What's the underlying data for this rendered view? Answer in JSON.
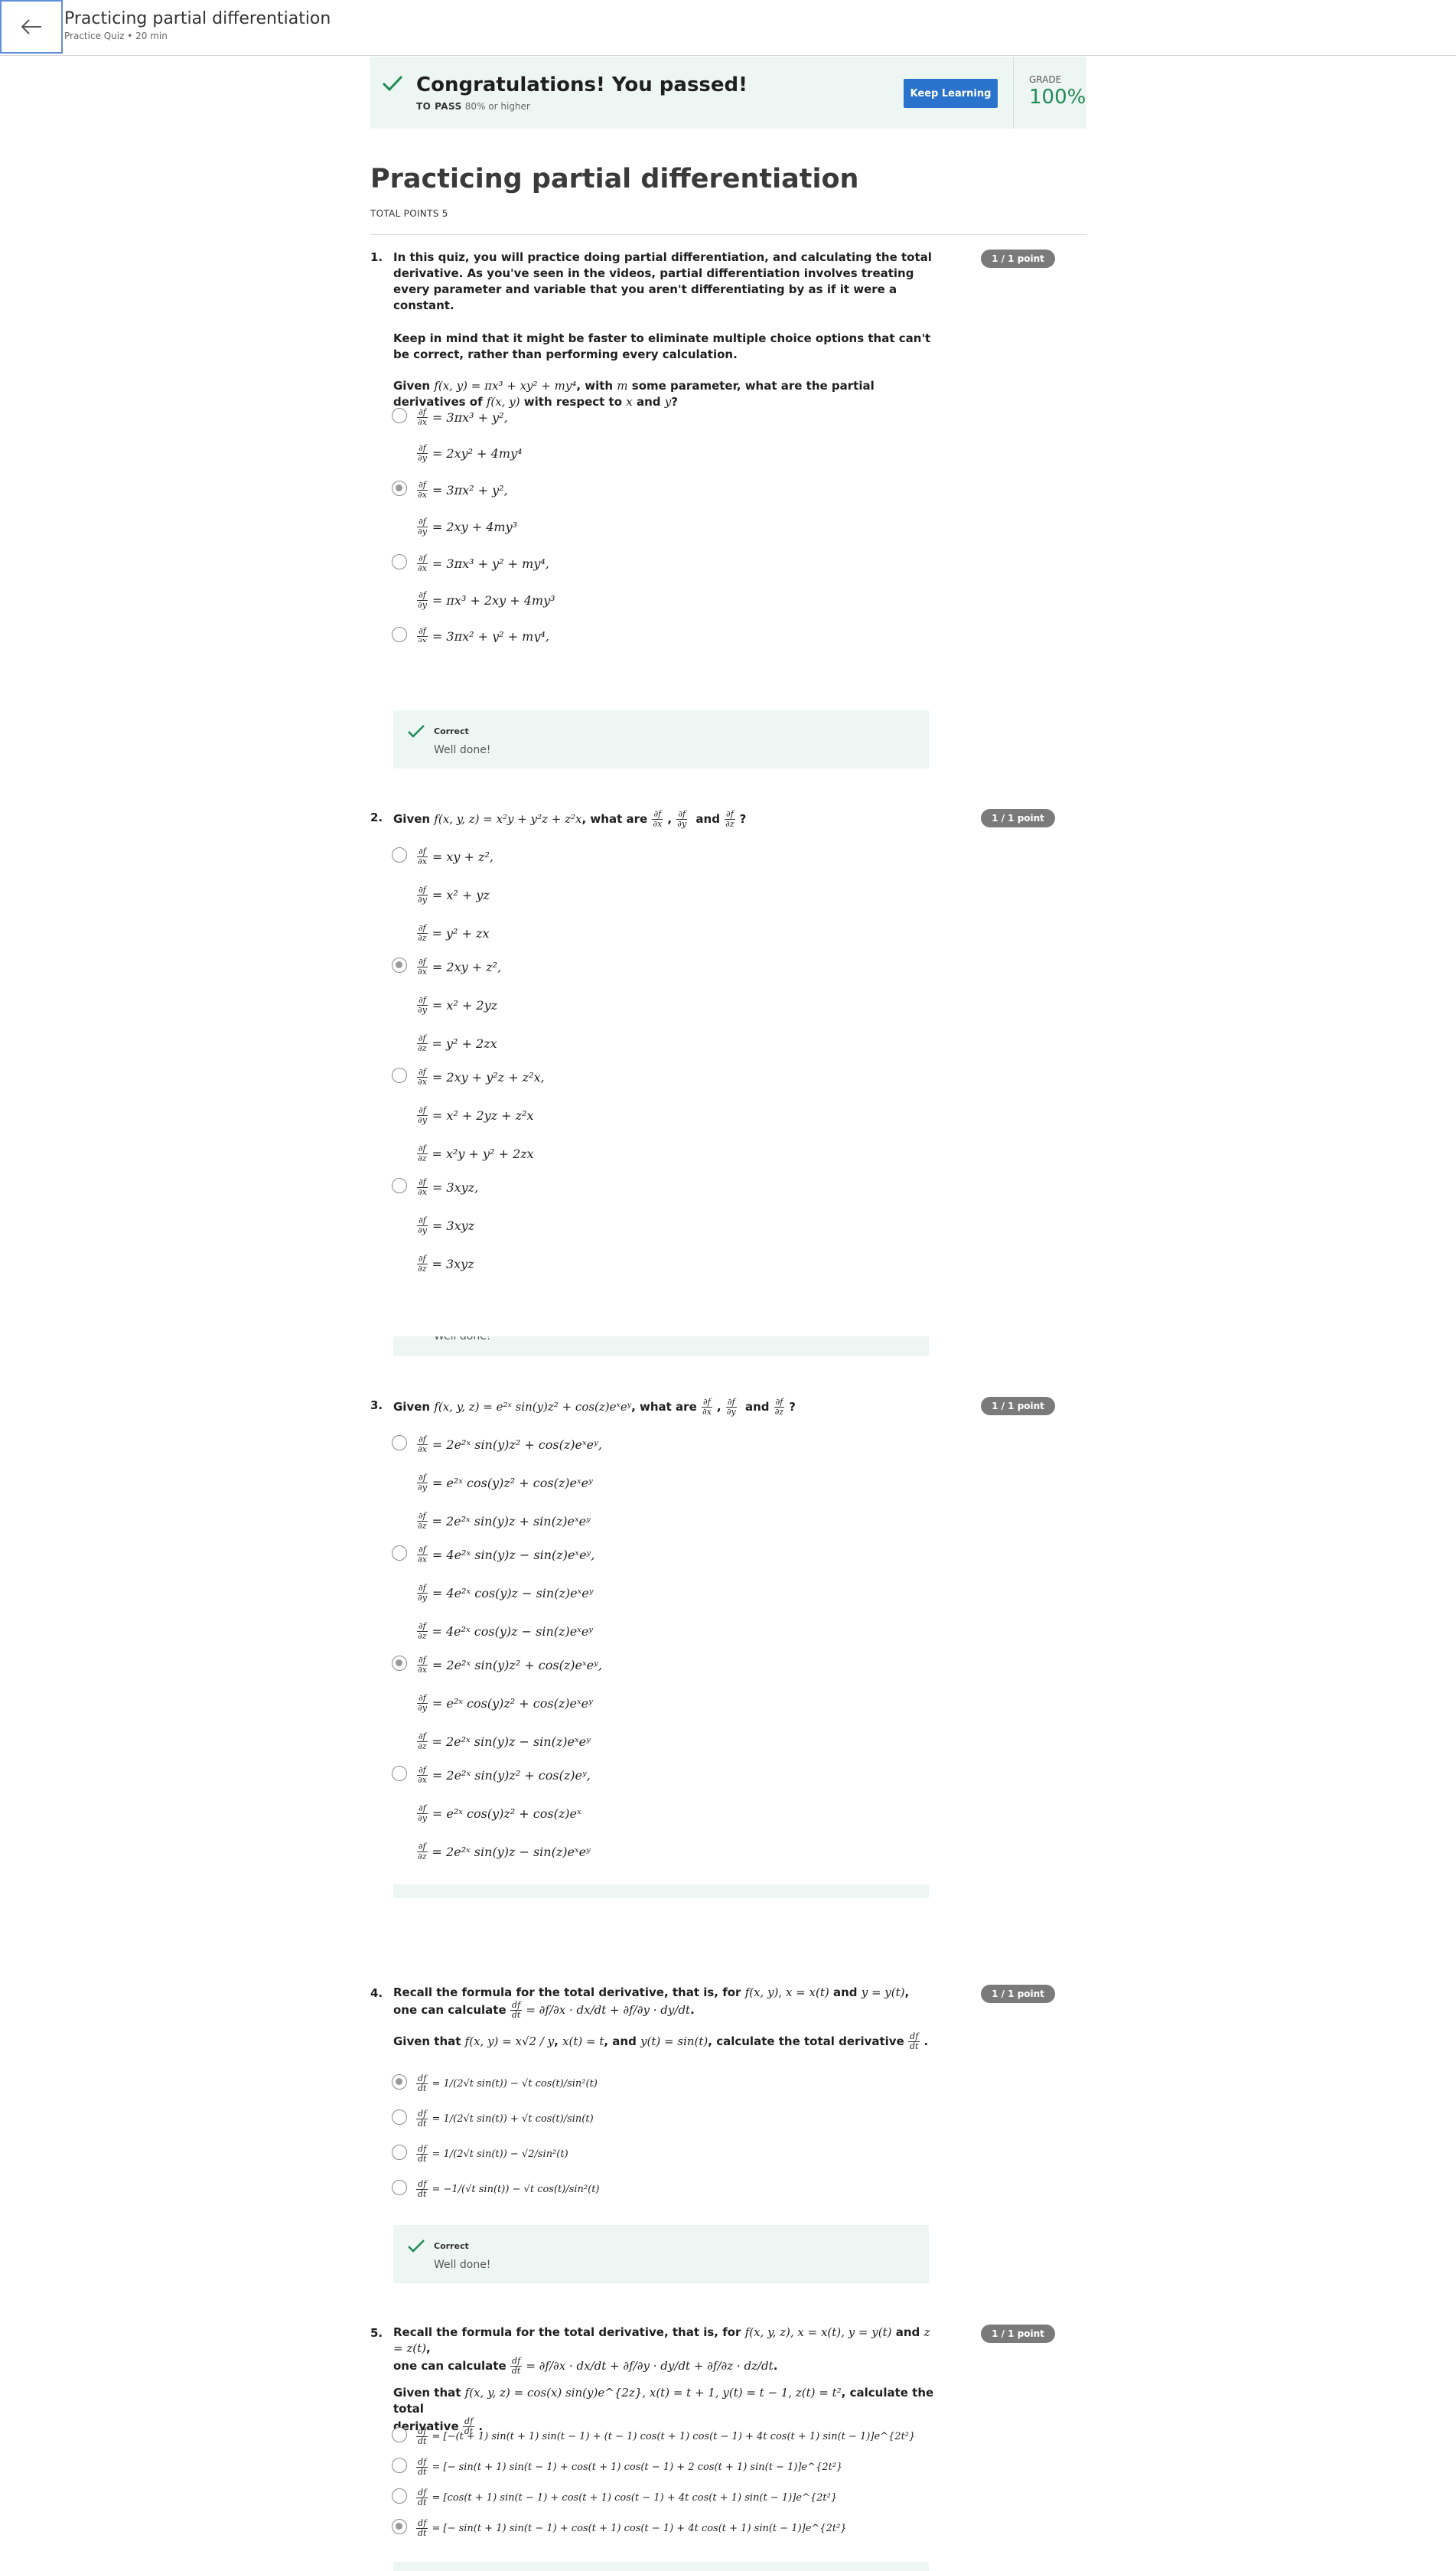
{
  "header": {
    "title": "Practicing partial differentiation",
    "subtitle": "Practice Quiz • 20 min"
  },
  "banner": {
    "title": "Congratulations! You passed!",
    "to_pass_label": "TO PASS",
    "to_pass_value": "80% or higher",
    "button": "Keep Learning",
    "grade_label": "GRADE",
    "grade_value": "100%"
  },
  "quiz": {
    "title": "Practicing partial differentiation",
    "total_points": "TOTAL POINTS 5"
  },
  "questions": [
    {
      "num": "1.",
      "points": "1 / 1 point",
      "para1": "In this quiz, you will practice doing partial differentiation, and calculating the total derivative. As you've seen in the videos, partial differentiation involves treating every parameter and variable that you aren't differentiating by as if it were a constant.",
      "para2": "Keep in mind that it might be faster to eliminate multiple choice options that can't be correct, rather than performing every calculation.",
      "prompt_a": "Given ",
      "prompt_math1": "f(x, y) = πx³ + xy² + my⁴",
      "prompt_b": ", with ",
      "prompt_math2": "m",
      "prompt_c": " some parameter, what are the partial derivatives of ",
      "prompt_math3": "f(x, y)",
      "prompt_d": " with respect to ",
      "prompt_math4": "x",
      "prompt_e": " and ",
      "prompt_math5": "y",
      "prompt_f": "?",
      "options": [
        [
          "= 3πx³ + y²,",
          "= 2xy² + 4my⁴"
        ],
        [
          "= 3πx² + y²,",
          "= 2xy + 4my³"
        ],
        [
          "= 3πx³ + y² + my⁴,",
          "= πx³ + 2xy + 4my³"
        ],
        [
          "= 3πx² + y² + my⁴,"
        ]
      ],
      "feedback_title": "Correct",
      "feedback_text": "Well done!"
    },
    {
      "num": "2.",
      "points": "1 / 1 point",
      "prompt_a": "Given ",
      "prompt_math": "f(x, y, z) = x²y + y²z + z²x",
      "prompt_b": ", what are",
      "prompt_c": "and",
      "options": [
        [
          "= xy + z²,",
          "= x² + yz",
          "= y² + zx"
        ],
        [
          "= 2xy + z²,",
          "= x² + 2yz",
          "= y² + 2zx"
        ],
        [
          "= 2xy + y²z + z²x,",
          "= x² + 2yz + z²x",
          "= x²y + y² + 2zx"
        ],
        [
          "= 3xyz,",
          "= 3xyz",
          "= 3xyz"
        ]
      ],
      "feedback_text": "Well done!"
    },
    {
      "num": "3.",
      "points": "1 / 1 point",
      "prompt_a": "Given ",
      "prompt_math": "f(x, y, z) = e²ˣ sin(y)z² + cos(z)eˣeʸ",
      "prompt_b": ", what are",
      "prompt_c": "and",
      "options": [
        [
          "= 2e²ˣ sin(y)z² + cos(z)eˣeʸ,",
          "= e²ˣ cos(y)z² + cos(z)eˣeʸ",
          "= 2e²ˣ sin(y)z + sin(z)eˣeʸ"
        ],
        [
          "= 4e²ˣ sin(y)z − sin(z)eˣeʸ,",
          "= 4e²ˣ cos(y)z − sin(z)eˣeʸ",
          "= 4e²ˣ cos(y)z − sin(z)eˣeʸ"
        ],
        [
          "= 2e²ˣ sin(y)z² + cos(z)eˣeʸ,",
          "= e²ˣ cos(y)z² + cos(z)eˣeʸ",
          "= 2e²ˣ sin(y)z − sin(z)eˣeʸ"
        ],
        [
          "= 2e²ˣ sin(y)z² + cos(z)eʸ,",
          "= e²ˣ cos(y)z² + cos(z)eˣ",
          "= 2e²ˣ sin(y)z − sin(z)eˣeʸ"
        ]
      ]
    },
    {
      "num": "4.",
      "points": "1 / 1 point",
      "prompt_a": "Recall the formula for the total derivative, that is, for ",
      "prompt_math1": "f(x, y), x = x(t)",
      "prompt_b": " and ",
      "prompt_math2": "y = y(t)",
      "prompt_c": ", one can calculate",
      "formula": "= ∂f/∂x · dx/dt + ∂f/∂y · dy/dt",
      "given_a": "Given that ",
      "given_math1": "f(x, y) = x√2 / y",
      "given_b": ", ",
      "given_math2": "x(t) = t",
      "given_c": ", and ",
      "given_math3": "y(t) = sin(t)",
      "given_d": ", calculate the total derivative",
      "options": [
        "= 1/(2√t sin(t)) − √t cos(t)/sin²(t)",
        "= 1/(2√t sin(t)) + √t cos(t)/sin(t)",
        "= 1/(2√t sin(t)) − √2/sin²(t)",
        "= −1/(√t sin(t)) − √t cos(t)/sin²(t)"
      ],
      "feedback_title": "Correct",
      "feedback_text": "Well done!"
    },
    {
      "num": "5.",
      "points": "1 / 1 point",
      "prompt_a": "Recall the formula for the total derivative, that is, for ",
      "prompt_math1": "f(x, y, z), x = x(t), y = y(t)",
      "prompt_b": " and ",
      "prompt_math2": "z = z(t)",
      "prompt_c": ",",
      "prompt_d": "one can calculate",
      "formula": "= ∂f/∂x · dx/dt + ∂f/∂y · dy/dt + ∂f/∂z · dz/dt",
      "given_a": "Given that ",
      "given_math": "f(x, y, z) = cos(x) sin(y)e^{2z}, x(t) = t + 1, y(t) = t − 1, z(t) = t²",
      "given_b": ", calculate the total",
      "given_c": "derivative",
      "options": [
        "= [−(t + 1) sin(t + 1) sin(t − 1) + (t − 1) cos(t + 1) cos(t − 1) + 4t cos(t + 1) sin(t − 1)]e^{2t²}",
        "= [− sin(t + 1) sin(t − 1) + cos(t + 1) cos(t − 1) + 2 cos(t + 1) sin(t − 1)]e^{2t²}",
        "= [cos(t + 1) sin(t − 1) + cos(t + 1) cos(t − 1) + 4t cos(t + 1) sin(t − 1)]e^{2t²}",
        "= [− sin(t + 1) sin(t − 1) + cos(t + 1) cos(t − 1) + 4t cos(t + 1) sin(t − 1)]e^{2t²}"
      ]
    }
  ],
  "frac": {
    "dfdx_num": "∂f",
    "dfdx_den": "∂x",
    "dfdy_num": "∂f",
    "dfdy_den": "∂y",
    "dfdz_num": "∂f",
    "dfdz_den": "∂z",
    "dfdt_num": "df",
    "dfdt_den": "dt"
  },
  "colors": {
    "accent": "#2a73cc",
    "success": "#1e8a55",
    "banner_bg": "#eef6f3",
    "badge": "#7a7a7a"
  }
}
